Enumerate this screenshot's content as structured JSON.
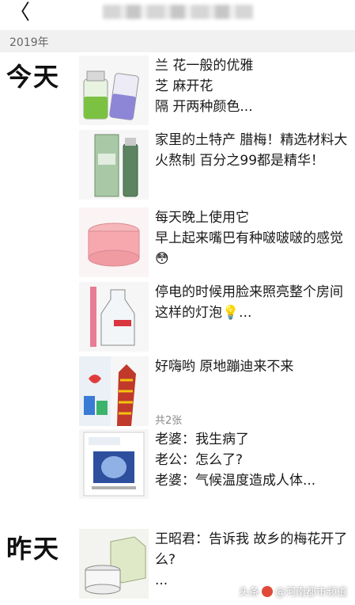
{
  "header": {
    "back_icon": "chevron-left-icon",
    "back_glyph": "〈"
  },
  "year_label": "2019年",
  "days": [
    {
      "label": "今天",
      "entries": [
        {
          "lines": [
            "兰  花一般的优雅",
            "芝  麻开花",
            "隔  开两种颜色..."
          ],
          "thumb": "two-bottles-green-purple"
        },
        {
          "lines": [
            "家里的土特产 腊梅！精选材料大火熬制 百分之99都是精华！"
          ],
          "thumb": "green-bottle-and-box"
        },
        {
          "lines": [
            "每天晚上使用它",
            "早上起来嘴巴有种啵啵啵的感觉😳"
          ],
          "thumb": "pink-lip-jar"
        },
        {
          "lines": [
            "停电的时候用脸来照亮整个房间",
            "这样的灯泡💡..."
          ],
          "thumb": "clear-essence-bottle"
        },
        {
          "lines": [
            "好嗨哟 原地蹦迪来不来"
          ],
          "thumb": "screenshot-collage",
          "count": "共2张"
        },
        {
          "lines": [
            "老婆：我生病了",
            "老公：怎么了?",
            "老婆：气候温度造成人体..."
          ],
          "thumb": "sheet-mask-pack"
        }
      ]
    },
    {
      "label": "昨天",
      "entries": [
        {
          "lines": [
            "王昭君：告诉我 故乡的梅花开了么?",
            "..."
          ],
          "thumb": "cream-jar-and-box"
        }
      ]
    }
  ],
  "watermark": {
    "prefix": "头条",
    "at": "@",
    "name": "河南都市频道"
  },
  "colors": {
    "year_bar": "#f1f1f1",
    "text": "#1a1a1a",
    "muted": "#888888"
  }
}
